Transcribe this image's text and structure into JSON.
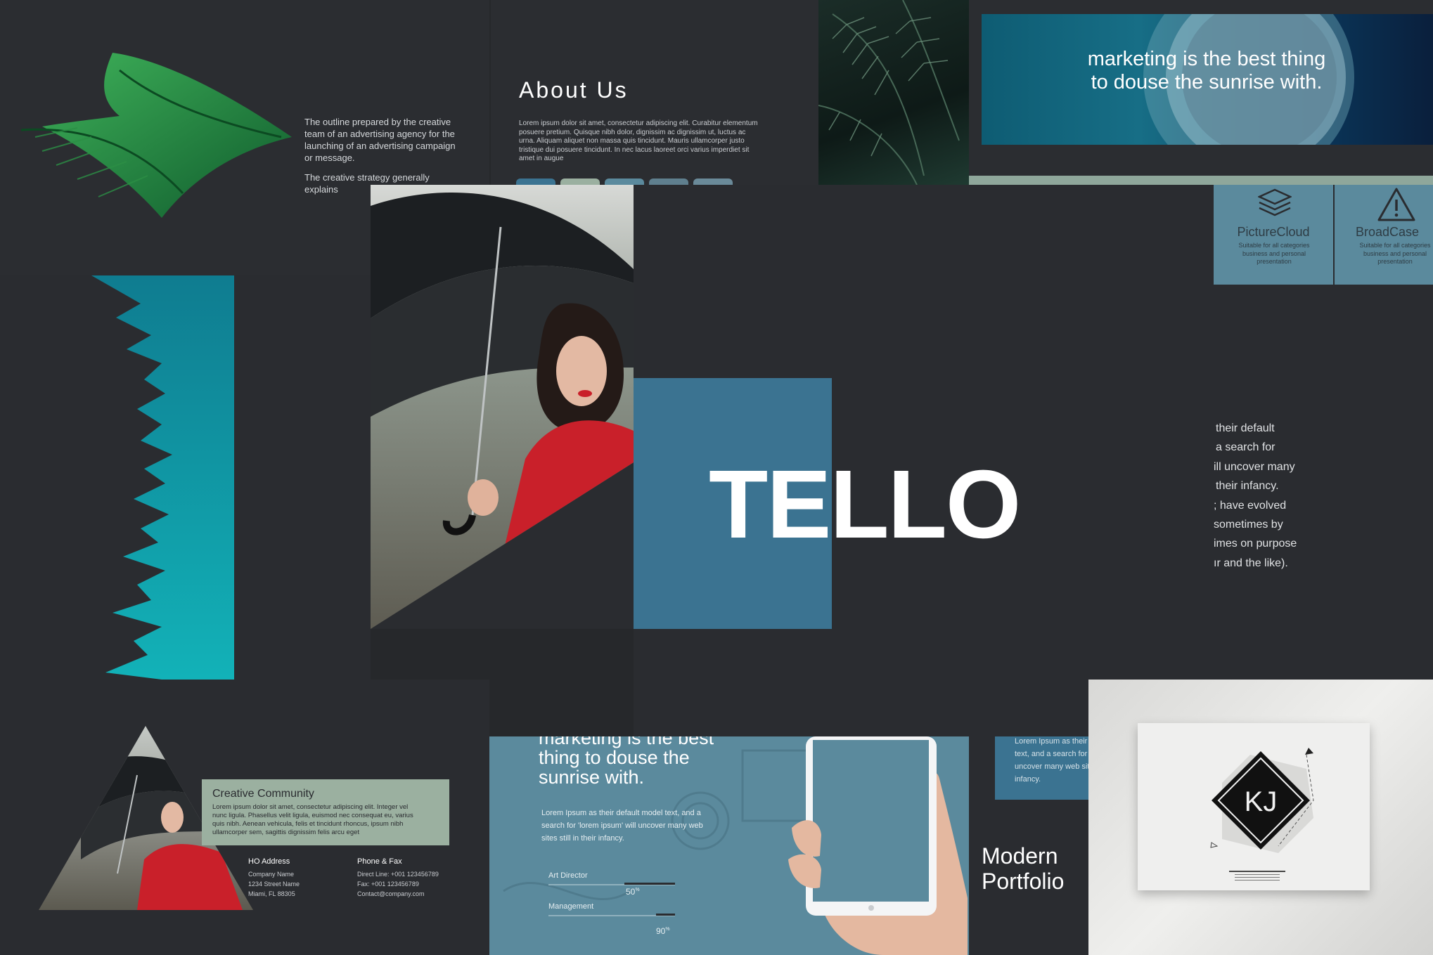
{
  "colors": {
    "background": "#26282b",
    "accent_blue": "#3b7391",
    "teal": "#12a6b2",
    "sage": "#9bb0a0",
    "muted_blue": "#5b8a9d",
    "red": "#c9202a"
  },
  "title": {
    "text": "TELLO"
  },
  "leaf_slide": {
    "para1": "The outline prepared by the creative team of an advertising agency for the launching of an advertising campaign or message.",
    "para2": "The creative strategy generally explains"
  },
  "about_slide": {
    "heading": "About Us",
    "body": "Lorem ipsum dolor sit amet, consectetur adipiscing elit. Curabitur elementum posuere pretium. Quisque nibh dolor, dignissim ac dignissim ut, luctus ac urna. Aliquam aliquet non massa quis tincidunt. Mauris ullamcorper justo tristique dui posuere tincidunt. In nec lacus laoreet orci varius imperdiet sit amet in augue"
  },
  "banner_slide": {
    "quote": "marketing is the best thing to douse the sunrise with."
  },
  "features": [
    {
      "title": "PictureCloud",
      "desc": "Suitable for all categories business and personal presentation",
      "icon": "layers-icon"
    },
    {
      "title": "BroadCase",
      "desc": "Suitable for all categories business and personal presentation",
      "icon": "warning-icon"
    }
  ],
  "right_text": {
    "lines": [
      "their default",
      "a search for",
      "ill uncover many",
      "their infancy.",
      "; have evolved",
      "sometimes by",
      "imes on purpose",
      "ır and the like)."
    ]
  },
  "contact_slide": {
    "heading": "Creative Community",
    "body": "Lorem ipsum dolor sit amet, consectetur adipiscing elit. Integer vel nunc ligula. Phasellus velit ligula, euismod nec consequat eu, varius quis nibh. Aenean vehicula, felis et tincidunt rhoncus, ipsum nibh ullamcorper sem, sagittis dignissim felis arcu eget",
    "address_title": "HO Address",
    "address_lines": [
      "Company Name",
      "1234 Street Name",
      "Miami, FL 88305"
    ],
    "phone_title": "Phone & Fax",
    "phone_lines": [
      "Direct Line: +001 123456789",
      "Fax: +001 123456789",
      "Contact@company.com"
    ]
  },
  "skills_slide": {
    "quote_top": "marketing is the best",
    "quote_rest": "thing to douse the sunrise with.",
    "body": "Lorem Ipsum as their default model text, and a search for 'lorem ipsum' will uncover many web sites still in their infancy.",
    "skills": [
      {
        "label": "Art Director",
        "value": "50",
        "unit": "%",
        "fraction": 0.5
      },
      {
        "label": "Management",
        "value": "90",
        "unit": "%",
        "fraction": 0.9
      }
    ]
  },
  "portfolio_slide": {
    "body": "Lorem Ipsum as their default model text, and a search for 'lorem ipsum' will uncover many web sites still in their infancy.",
    "title_line1": "Modern",
    "title_line2": "Portfolio"
  },
  "logo_card": {
    "monogram": "KJ"
  }
}
